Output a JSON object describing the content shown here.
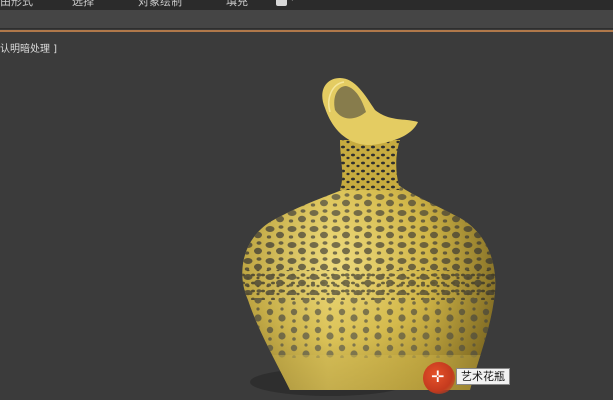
{
  "menubar": {
    "items": [
      "由形式",
      "选择",
      "对象绘制",
      "填充"
    ]
  },
  "viewport": {
    "label": "认明暗处理 ]",
    "object_tooltip": "艺术花瓶"
  },
  "colors": {
    "vase_gold": "#d8c055",
    "viewport_bg": "#3b3b3b",
    "accent": "#b0784a",
    "cursor": "#d8452a"
  }
}
